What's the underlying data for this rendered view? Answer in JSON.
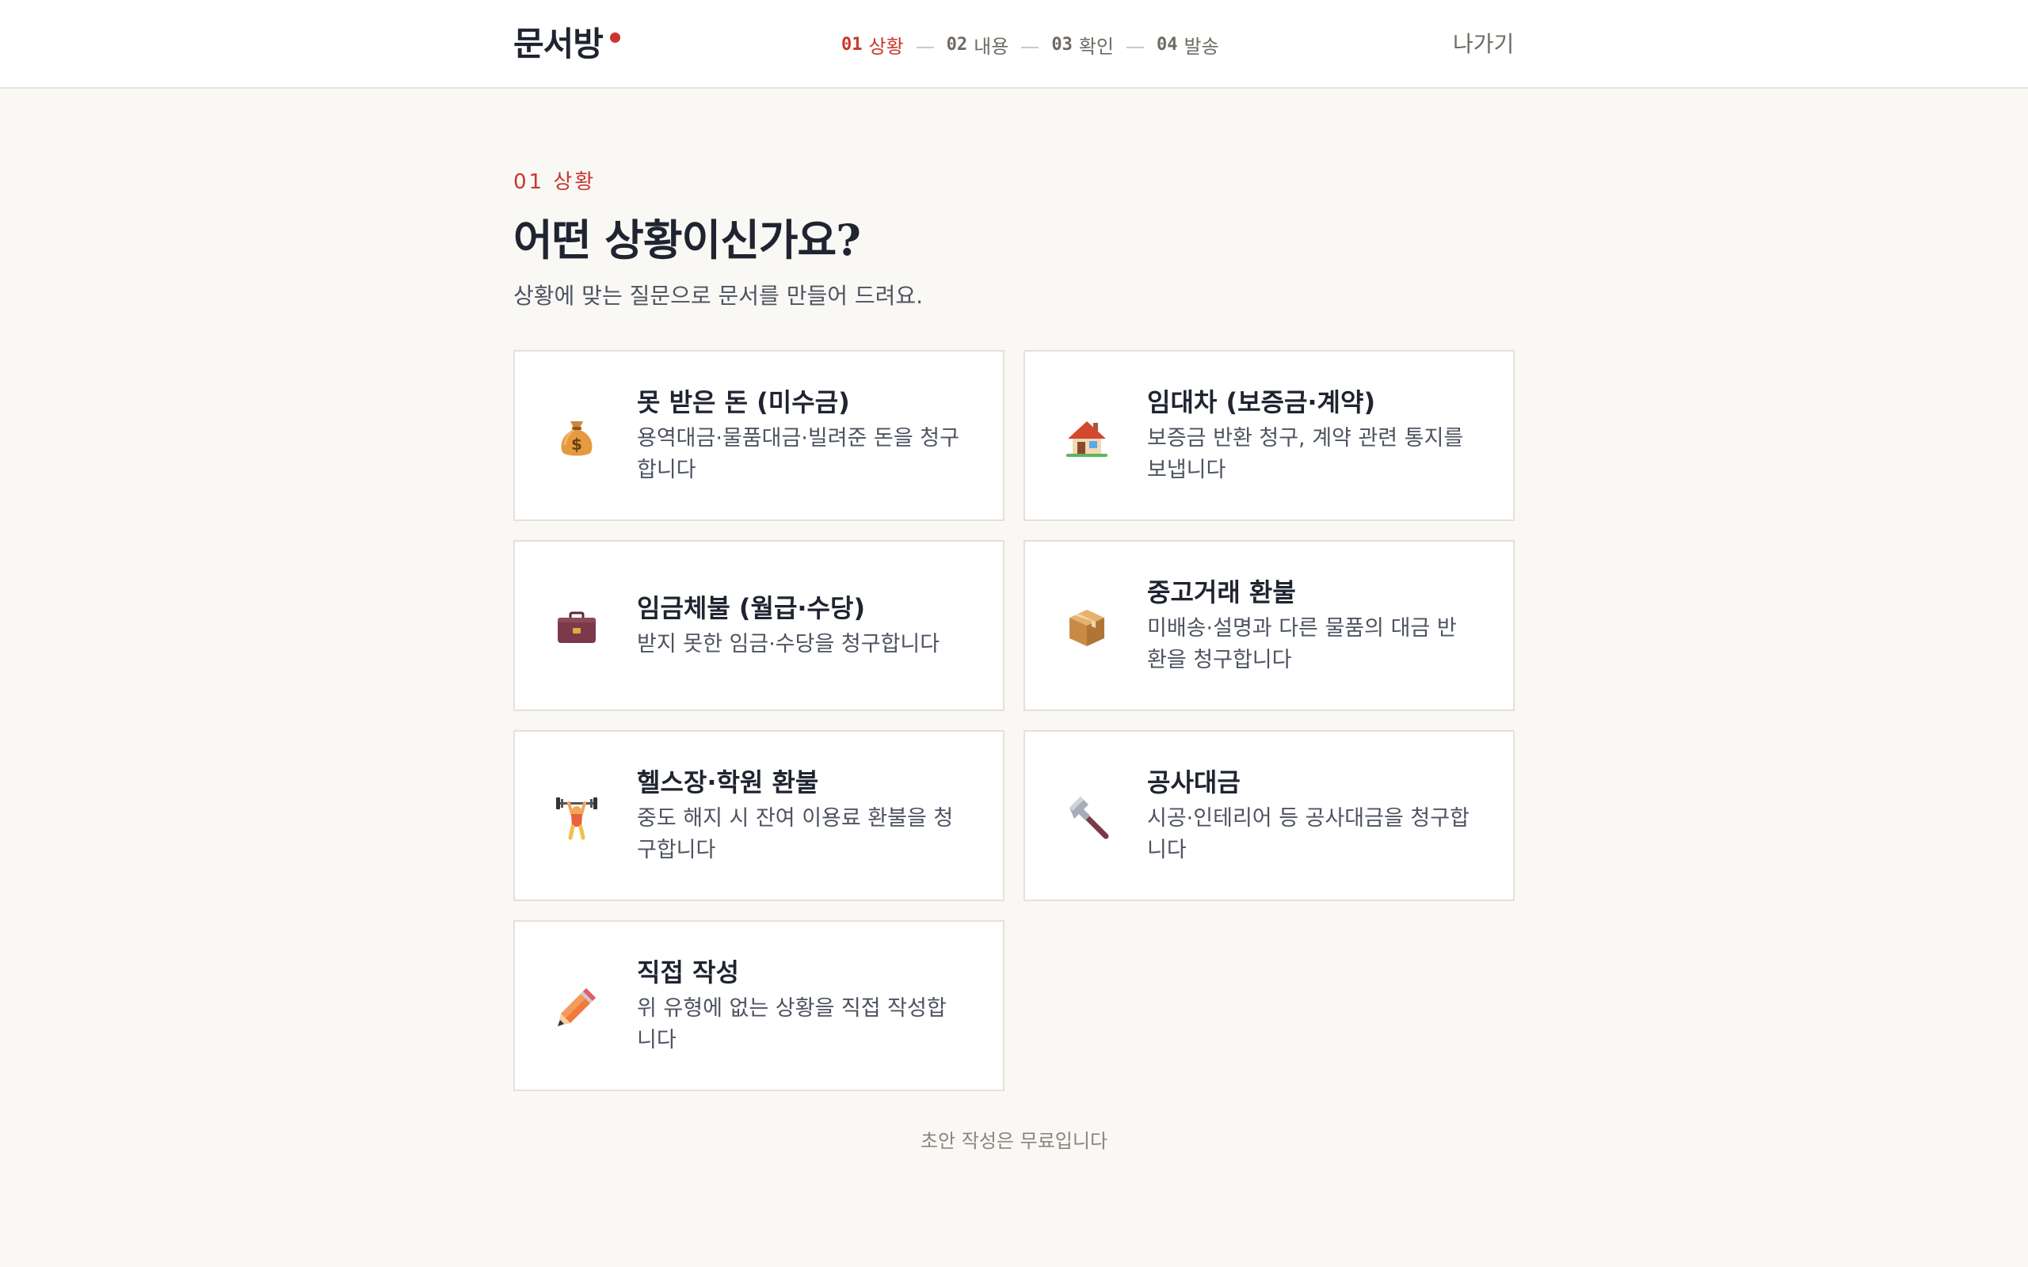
{
  "app": {
    "logo": "문서방",
    "brand_color": "#c8372d"
  },
  "steps": [
    {
      "num": "01",
      "label": "상황",
      "active": true
    },
    {
      "num": "02",
      "label": "내용",
      "active": false
    },
    {
      "num": "03",
      "label": "확인",
      "active": false
    },
    {
      "num": "04",
      "label": "발송",
      "active": false
    }
  ],
  "header": {
    "exit_label": "나가기"
  },
  "main": {
    "eyebrow": "01 상황",
    "title": "어떤 상황이신가요?",
    "subtitle": "상황에 맞는 질문으로 문서를 만들어 드려요.",
    "cards": [
      {
        "icon": "money-bag-icon",
        "title": "못 받은 돈 (미수금)",
        "desc": "용역대금·물품대금·빌려준 돈을 청구합니다"
      },
      {
        "icon": "house-icon",
        "title": "임대차 (보증금·계약)",
        "desc": "보증금 반환 청구, 계약 관련 통지를 보냅니다"
      },
      {
        "icon": "briefcase-icon",
        "title": "임금체불 (월급·수당)",
        "desc": "받지 못한 임금·수당을 청구합니다"
      },
      {
        "icon": "package-icon",
        "title": "중고거래 환불",
        "desc": "미배송·설명과 다른 물품의 대금 반환을 청구합니다"
      },
      {
        "icon": "weightlifter-icon",
        "title": "헬스장·학원 환불",
        "desc": "중도 해지 시 잔여 이용료 환불을 청구합니다"
      },
      {
        "icon": "hammer-icon",
        "title": "공사대금",
        "desc": "시공·인테리어 등 공사대금을 청구합니다"
      },
      {
        "icon": "pencil-icon",
        "title": "직접 작성",
        "desc": "위 유형에 없는 상황을 직접 작성합니다"
      }
    ],
    "footnote": "초안 작성은 무료입니다"
  }
}
